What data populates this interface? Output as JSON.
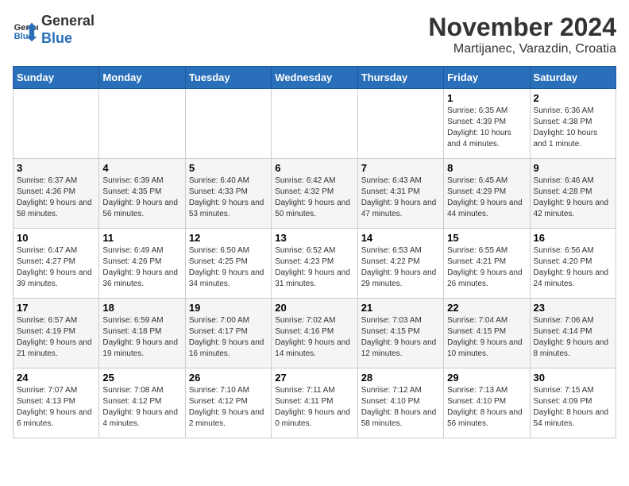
{
  "header": {
    "logo_general": "General",
    "logo_blue": "Blue",
    "month_title": "November 2024",
    "subtitle": "Martijanec, Varazdin, Croatia"
  },
  "calendar": {
    "days_of_week": [
      "Sunday",
      "Monday",
      "Tuesday",
      "Wednesday",
      "Thursday",
      "Friday",
      "Saturday"
    ],
    "weeks": [
      [
        {
          "day": "",
          "info": ""
        },
        {
          "day": "",
          "info": ""
        },
        {
          "day": "",
          "info": ""
        },
        {
          "day": "",
          "info": ""
        },
        {
          "day": "",
          "info": ""
        },
        {
          "day": "1",
          "info": "Sunrise: 6:35 AM\nSunset: 4:39 PM\nDaylight: 10 hours and 4 minutes."
        },
        {
          "day": "2",
          "info": "Sunrise: 6:36 AM\nSunset: 4:38 PM\nDaylight: 10 hours and 1 minute."
        }
      ],
      [
        {
          "day": "3",
          "info": "Sunrise: 6:37 AM\nSunset: 4:36 PM\nDaylight: 9 hours and 58 minutes."
        },
        {
          "day": "4",
          "info": "Sunrise: 6:39 AM\nSunset: 4:35 PM\nDaylight: 9 hours and 56 minutes."
        },
        {
          "day": "5",
          "info": "Sunrise: 6:40 AM\nSunset: 4:33 PM\nDaylight: 9 hours and 53 minutes."
        },
        {
          "day": "6",
          "info": "Sunrise: 6:42 AM\nSunset: 4:32 PM\nDaylight: 9 hours and 50 minutes."
        },
        {
          "day": "7",
          "info": "Sunrise: 6:43 AM\nSunset: 4:31 PM\nDaylight: 9 hours and 47 minutes."
        },
        {
          "day": "8",
          "info": "Sunrise: 6:45 AM\nSunset: 4:29 PM\nDaylight: 9 hours and 44 minutes."
        },
        {
          "day": "9",
          "info": "Sunrise: 6:46 AM\nSunset: 4:28 PM\nDaylight: 9 hours and 42 minutes."
        }
      ],
      [
        {
          "day": "10",
          "info": "Sunrise: 6:47 AM\nSunset: 4:27 PM\nDaylight: 9 hours and 39 minutes."
        },
        {
          "day": "11",
          "info": "Sunrise: 6:49 AM\nSunset: 4:26 PM\nDaylight: 9 hours and 36 minutes."
        },
        {
          "day": "12",
          "info": "Sunrise: 6:50 AM\nSunset: 4:25 PM\nDaylight: 9 hours and 34 minutes."
        },
        {
          "day": "13",
          "info": "Sunrise: 6:52 AM\nSunset: 4:23 PM\nDaylight: 9 hours and 31 minutes."
        },
        {
          "day": "14",
          "info": "Sunrise: 6:53 AM\nSunset: 4:22 PM\nDaylight: 9 hours and 29 minutes."
        },
        {
          "day": "15",
          "info": "Sunrise: 6:55 AM\nSunset: 4:21 PM\nDaylight: 9 hours and 26 minutes."
        },
        {
          "day": "16",
          "info": "Sunrise: 6:56 AM\nSunset: 4:20 PM\nDaylight: 9 hours and 24 minutes."
        }
      ],
      [
        {
          "day": "17",
          "info": "Sunrise: 6:57 AM\nSunset: 4:19 PM\nDaylight: 9 hours and 21 minutes."
        },
        {
          "day": "18",
          "info": "Sunrise: 6:59 AM\nSunset: 4:18 PM\nDaylight: 9 hours and 19 minutes."
        },
        {
          "day": "19",
          "info": "Sunrise: 7:00 AM\nSunset: 4:17 PM\nDaylight: 9 hours and 16 minutes."
        },
        {
          "day": "20",
          "info": "Sunrise: 7:02 AM\nSunset: 4:16 PM\nDaylight: 9 hours and 14 minutes."
        },
        {
          "day": "21",
          "info": "Sunrise: 7:03 AM\nSunset: 4:15 PM\nDaylight: 9 hours and 12 minutes."
        },
        {
          "day": "22",
          "info": "Sunrise: 7:04 AM\nSunset: 4:15 PM\nDaylight: 9 hours and 10 minutes."
        },
        {
          "day": "23",
          "info": "Sunrise: 7:06 AM\nSunset: 4:14 PM\nDaylight: 9 hours and 8 minutes."
        }
      ],
      [
        {
          "day": "24",
          "info": "Sunrise: 7:07 AM\nSunset: 4:13 PM\nDaylight: 9 hours and 6 minutes."
        },
        {
          "day": "25",
          "info": "Sunrise: 7:08 AM\nSunset: 4:12 PM\nDaylight: 9 hours and 4 minutes."
        },
        {
          "day": "26",
          "info": "Sunrise: 7:10 AM\nSunset: 4:12 PM\nDaylight: 9 hours and 2 minutes."
        },
        {
          "day": "27",
          "info": "Sunrise: 7:11 AM\nSunset: 4:11 PM\nDaylight: 9 hours and 0 minutes."
        },
        {
          "day": "28",
          "info": "Sunrise: 7:12 AM\nSunset: 4:10 PM\nDaylight: 8 hours and 58 minutes."
        },
        {
          "day": "29",
          "info": "Sunrise: 7:13 AM\nSunset: 4:10 PM\nDaylight: 8 hours and 56 minutes."
        },
        {
          "day": "30",
          "info": "Sunrise: 7:15 AM\nSunset: 4:09 PM\nDaylight: 8 hours and 54 minutes."
        }
      ]
    ]
  }
}
